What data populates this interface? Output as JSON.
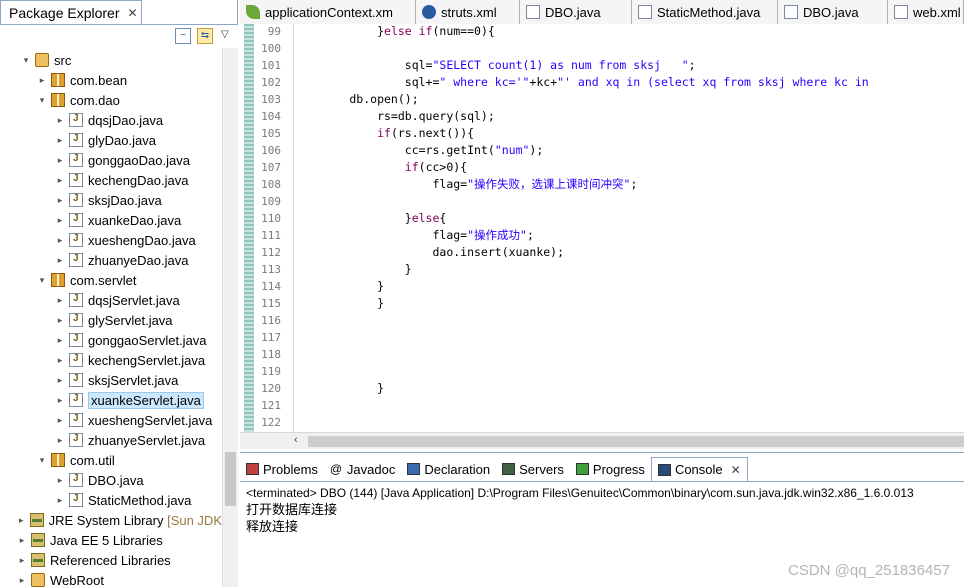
{
  "package_explorer": {
    "tab_title": "Package Explorer",
    "tree": [
      {
        "label": "src",
        "icon": "source-folder-icon",
        "arrow": "▾",
        "indent": 20
      },
      {
        "label": "com.bean",
        "icon": "package-icon",
        "arrow": "▸",
        "indent": 36
      },
      {
        "label": "com.dao",
        "icon": "package-icon",
        "arrow": "▾",
        "indent": 36
      },
      {
        "label": "dqsjDao.java",
        "icon": "java-file-icon",
        "arrow": "▸",
        "indent": 54
      },
      {
        "label": "glyDao.java",
        "icon": "java-file-icon",
        "arrow": "▸",
        "indent": 54
      },
      {
        "label": "gonggaoDao.java",
        "icon": "java-file-icon",
        "arrow": "▸",
        "indent": 54
      },
      {
        "label": "kechengDao.java",
        "icon": "java-file-icon",
        "arrow": "▸",
        "indent": 54
      },
      {
        "label": "sksjDao.java",
        "icon": "java-file-icon",
        "arrow": "▸",
        "indent": 54
      },
      {
        "label": "xuankeDao.java",
        "icon": "java-file-icon",
        "arrow": "▸",
        "indent": 54
      },
      {
        "label": "xueshengDao.java",
        "icon": "java-file-icon",
        "arrow": "▸",
        "indent": 54
      },
      {
        "label": "zhuanyeDao.java",
        "icon": "java-file-icon",
        "arrow": "▸",
        "indent": 54
      },
      {
        "label": "com.servlet",
        "icon": "package-icon",
        "arrow": "▾",
        "indent": 36
      },
      {
        "label": "dqsjServlet.java",
        "icon": "java-file-icon",
        "arrow": "▸",
        "indent": 54
      },
      {
        "label": "glyServlet.java",
        "icon": "java-file-icon",
        "arrow": "▸",
        "indent": 54
      },
      {
        "label": "gonggaoServlet.java",
        "icon": "java-file-icon",
        "arrow": "▸",
        "indent": 54
      },
      {
        "label": "kechengServlet.java",
        "icon": "java-file-icon",
        "arrow": "▸",
        "indent": 54
      },
      {
        "label": "sksjServlet.java",
        "icon": "java-file-icon",
        "arrow": "▸",
        "indent": 54
      },
      {
        "label": "xuankeServlet.java",
        "icon": "java-file-icon",
        "arrow": "▸",
        "indent": 54,
        "selected": true
      },
      {
        "label": "xueshengServlet.java",
        "icon": "java-file-icon",
        "arrow": "▸",
        "indent": 54
      },
      {
        "label": "zhuanyeServlet.java",
        "icon": "java-file-icon",
        "arrow": "▸",
        "indent": 54
      },
      {
        "label": "com.util",
        "icon": "package-icon",
        "arrow": "▾",
        "indent": 36
      },
      {
        "label": "DBO.java",
        "icon": "java-file-icon",
        "arrow": "▸",
        "indent": 54
      },
      {
        "label": "StaticMethod.java",
        "icon": "java-file-icon",
        "arrow": "▸",
        "indent": 54
      },
      {
        "label": "JRE System Library",
        "suffix": " [Sun JDK",
        "icon": "library-icon",
        "arrow": "▸",
        "indent": 16
      },
      {
        "label": "Java EE 5 Libraries",
        "icon": "library-icon",
        "arrow": "▸",
        "indent": 16
      },
      {
        "label": "Referenced Libraries",
        "icon": "library-icon",
        "arrow": "▸",
        "indent": 16
      },
      {
        "label": "WebRoot",
        "icon": "folder-icon",
        "arrow": "▸",
        "indent": 16
      }
    ]
  },
  "editor": {
    "tabs": [
      {
        "label": "applicationContext.xm",
        "icon": "spring-leaf-icon"
      },
      {
        "label": "struts.xml",
        "icon": "gear-icon"
      },
      {
        "label": "DBO.java",
        "icon": "java-file-icon"
      },
      {
        "label": "StaticMethod.java",
        "icon": "java-file-icon"
      },
      {
        "label": "DBO.java",
        "icon": "java-file-icon"
      },
      {
        "label": "web.xml",
        "icon": "xml-file-icon"
      }
    ],
    "lines": [
      {
        "n": "99",
        "parts": [
          {
            "t": "            }",
            "c": ""
          },
          {
            "t": "else if",
            "c": "kw"
          },
          {
            "t": "(num==0){",
            "c": ""
          }
        ]
      },
      {
        "n": "100",
        "parts": []
      },
      {
        "n": "101",
        "parts": [
          {
            "t": "                sql=",
            "c": ""
          },
          {
            "t": "\"SELECT count(1) as num from sksj   \"",
            "c": "str"
          },
          {
            "t": ";",
            "c": ""
          }
        ]
      },
      {
        "n": "102",
        "parts": [
          {
            "t": "                sql+=",
            "c": ""
          },
          {
            "t": "\" where kc='\"",
            "c": "str"
          },
          {
            "t": "+kc+",
            "c": ""
          },
          {
            "t": "\"' and xq in (select xq from sksj where kc in",
            "c": "str"
          }
        ]
      },
      {
        "n": "103",
        "parts": [
          {
            "t": "        db.open();",
            "c": ""
          }
        ]
      },
      {
        "n": "104",
        "parts": [
          {
            "t": "            rs=db.query(sql);",
            "c": ""
          }
        ]
      },
      {
        "n": "105",
        "parts": [
          {
            "t": "            ",
            "c": ""
          },
          {
            "t": "if",
            "c": "kw"
          },
          {
            "t": "(rs.next()){",
            "c": ""
          }
        ]
      },
      {
        "n": "106",
        "parts": [
          {
            "t": "                cc=rs.getInt(",
            "c": ""
          },
          {
            "t": "\"num\"",
            "c": "str"
          },
          {
            "t": ");",
            "c": ""
          }
        ]
      },
      {
        "n": "107",
        "parts": [
          {
            "t": "                ",
            "c": ""
          },
          {
            "t": "if",
            "c": "kw"
          },
          {
            "t": "(cc>0){",
            "c": ""
          }
        ]
      },
      {
        "n": "108",
        "parts": [
          {
            "t": "                    flag=",
            "c": ""
          },
          {
            "t": "\"操作失败，选课上课时间冲突\"",
            "c": "str"
          },
          {
            "t": ";",
            "c": ""
          }
        ]
      },
      {
        "n": "109",
        "parts": []
      },
      {
        "n": "110",
        "parts": [
          {
            "t": "                }",
            "c": ""
          },
          {
            "t": "else",
            "c": "kw"
          },
          {
            "t": "{",
            "c": ""
          }
        ]
      },
      {
        "n": "111",
        "parts": [
          {
            "t": "                    flag=",
            "c": ""
          },
          {
            "t": "\"操作成功\"",
            "c": "str"
          },
          {
            "t": ";",
            "c": ""
          }
        ]
      },
      {
        "n": "112",
        "parts": [
          {
            "t": "                    dao.insert(xuanke);",
            "c": ""
          }
        ]
      },
      {
        "n": "113",
        "parts": [
          {
            "t": "                }",
            "c": ""
          }
        ]
      },
      {
        "n": "114",
        "parts": [
          {
            "t": "            }",
            "c": ""
          }
        ]
      },
      {
        "n": "115",
        "parts": [
          {
            "t": "            }",
            "c": ""
          }
        ]
      },
      {
        "n": "116",
        "parts": []
      },
      {
        "n": "117",
        "parts": []
      },
      {
        "n": "118",
        "parts": []
      },
      {
        "n": "119",
        "parts": []
      },
      {
        "n": "120",
        "parts": [
          {
            "t": "            }",
            "c": ""
          }
        ]
      },
      {
        "n": "121",
        "parts": []
      },
      {
        "n": "122",
        "parts": []
      }
    ]
  },
  "bottom_view": {
    "tabs": [
      {
        "label": "Problems",
        "icon": "problems-icon",
        "active": false
      },
      {
        "label": "Javadoc",
        "icon": "at-sign-icon",
        "active": false
      },
      {
        "label": "Declaration",
        "icon": "declaration-icon",
        "active": false
      },
      {
        "label": "Servers",
        "icon": "servers-icon",
        "active": false
      },
      {
        "label": "Progress",
        "icon": "progress-icon",
        "active": false
      },
      {
        "label": "Console",
        "icon": "console-icon",
        "active": true
      }
    ],
    "terminated_line": "<terminated> DBO (144) [Java Application] D:\\Program Files\\Genuitec\\Common\\binary\\com.sun.java.jdk.win32.x86_1.6.0.013",
    "output": [
      "打开数据库连接",
      "释放连接"
    ]
  },
  "watermark": "CSDN @qq_251836457"
}
